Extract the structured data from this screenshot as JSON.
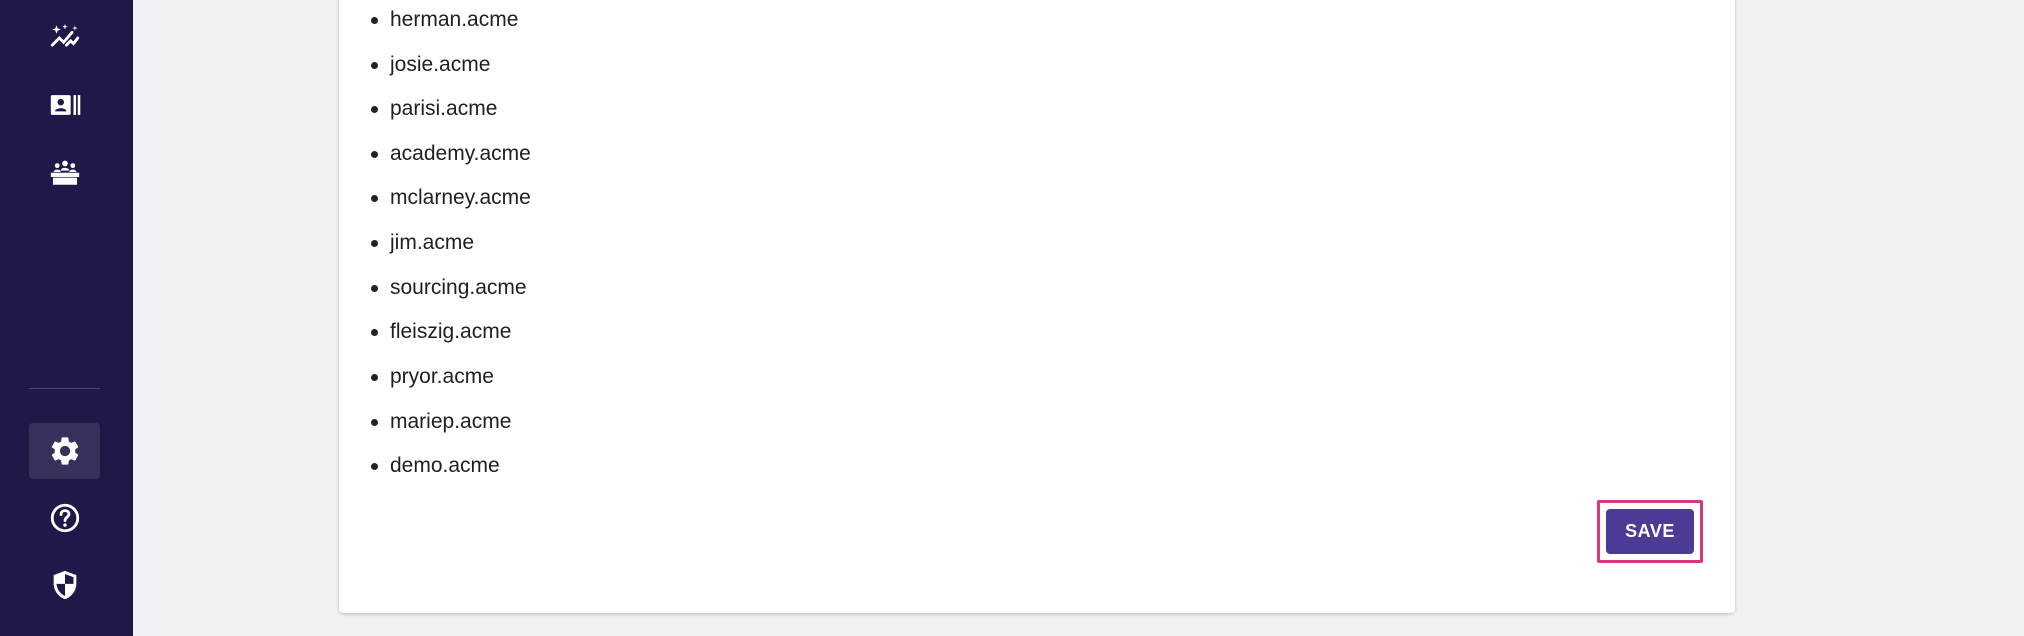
{
  "sidebar": {
    "background": "#201848",
    "nav_top": [
      {
        "icon": "sparkle-chart-icon"
      },
      {
        "icon": "contact-card-icon"
      },
      {
        "icon": "team-icon"
      }
    ],
    "nav_bottom": [
      {
        "icon": "gear-icon",
        "active": true
      },
      {
        "icon": "help-circle-icon"
      },
      {
        "icon": "shield-icon"
      }
    ]
  },
  "domains": [
    "herman.acme",
    "josie.acme",
    "parisi.acme",
    "academy.acme",
    "mclarney.acme",
    "jim.acme",
    "sourcing.acme",
    "fleiszig.acme",
    "pryor.acme",
    "mariep.acme",
    "demo.acme"
  ],
  "actions": {
    "save_label": "SAVE",
    "save_color": "#4c3b94",
    "highlight_color": "#d6397d"
  }
}
